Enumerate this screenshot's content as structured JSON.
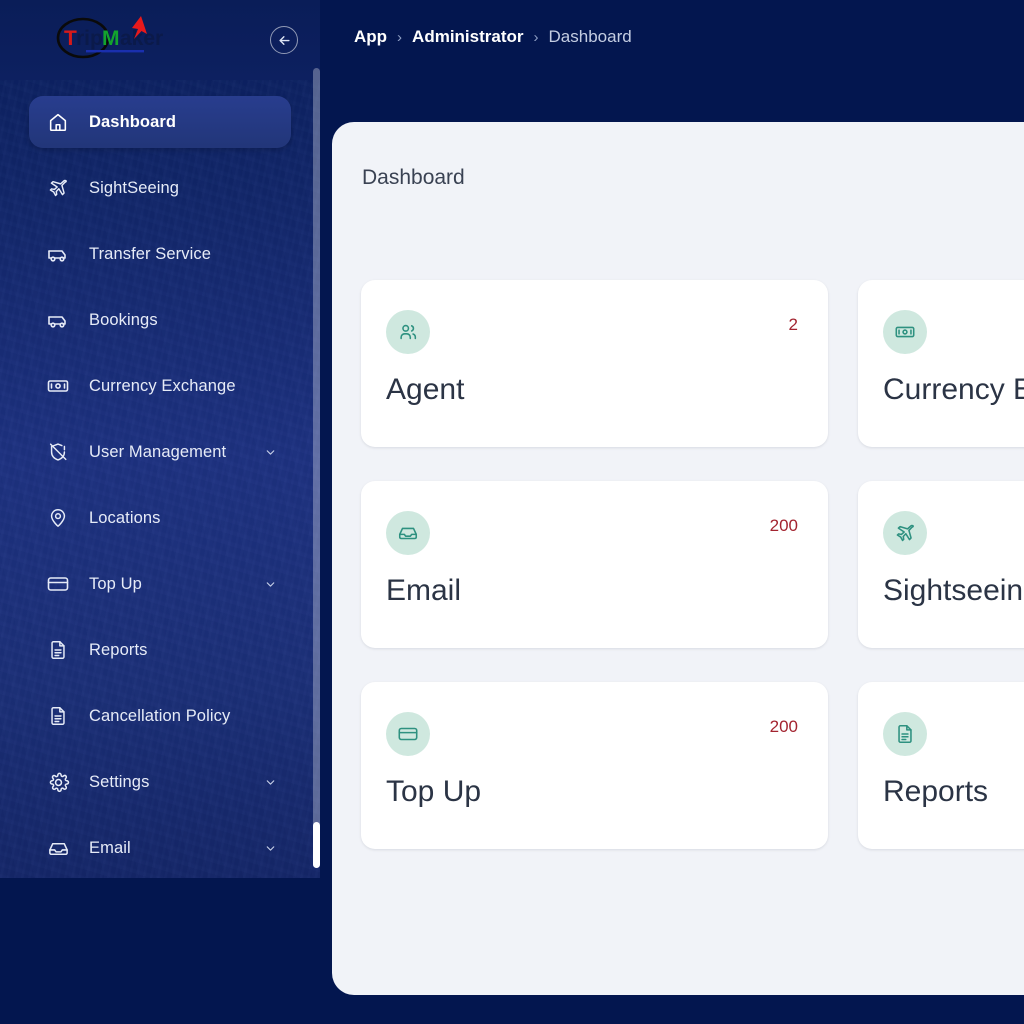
{
  "brand": {
    "name": "TripMaker",
    "letters": [
      {
        "t": "T",
        "color": "#d61a1a"
      },
      {
        "t": "rip",
        "color": "#0b1a4a"
      },
      {
        "t": "M",
        "color": "#13a32e"
      },
      {
        "t": "aker",
        "color": "#0b1a4a"
      }
    ],
    "accent_arrow_color": "#e8191b",
    "ring_color": "#0a0a0a"
  },
  "header": {
    "collapse_button_label": "Collapse sidebar",
    "collapse_icon": "arrow-left-circle-icon",
    "breadcrumb": {
      "items": [
        {
          "label": "App",
          "current": false
        },
        {
          "label": "Administrator",
          "current": false
        },
        {
          "label": "Dashboard",
          "current": true
        }
      ],
      "separator": "›"
    }
  },
  "sidebar": {
    "active_item": "Dashboard",
    "items": [
      {
        "label": "Dashboard",
        "icon": "home-icon",
        "active": true,
        "expandable": false
      },
      {
        "label": "SightSeeing",
        "icon": "plane-icon",
        "active": false,
        "expandable": false
      },
      {
        "label": "Transfer Service",
        "icon": "car-icon",
        "active": false,
        "expandable": false
      },
      {
        "label": "Bookings",
        "icon": "car-icon",
        "active": false,
        "expandable": false
      },
      {
        "label": "Currency Exchange",
        "icon": "banknote-icon",
        "active": false,
        "expandable": false
      },
      {
        "label": "User Management",
        "icon": "shield-off-icon",
        "active": false,
        "expandable": true
      },
      {
        "label": "Locations",
        "icon": "map-pin-icon",
        "active": false,
        "expandable": false
      },
      {
        "label": "Top Up",
        "icon": "credit-card-icon",
        "active": false,
        "expandable": true
      },
      {
        "label": "Reports",
        "icon": "document-icon",
        "active": false,
        "expandable": false
      },
      {
        "label": "Cancellation Policy",
        "icon": "document-icon",
        "active": false,
        "expandable": false
      },
      {
        "label": "Settings",
        "icon": "gear-icon",
        "active": false,
        "expandable": true
      },
      {
        "label": "Email",
        "icon": "inbox-icon",
        "active": false,
        "expandable": true
      }
    ],
    "scrollbar": {
      "name": "sidebar-scrollbar",
      "position": "bottom"
    }
  },
  "main": {
    "title": "Dashboard",
    "cards": [
      {
        "title": "Agent",
        "count": "2",
        "icon": "users-icon"
      },
      {
        "title": "Currency Exchange",
        "count": "",
        "icon": "banknote-icon"
      },
      {
        "title": "Email",
        "count": "200",
        "icon": "inbox-icon"
      },
      {
        "title": "Sightseeing",
        "count": "",
        "icon": "plane-icon"
      },
      {
        "title": "Top Up",
        "count": "200",
        "icon": "credit-card-icon"
      },
      {
        "title": "Reports",
        "count": "",
        "icon": "document-icon"
      }
    ]
  },
  "colors": {
    "page_background": "#03164f",
    "sidebar_gradient_top": "#0a1f5e",
    "sidebar_gradient_mid": "#1e3282",
    "panel_background": "#f1f3f8",
    "card_background": "#ffffff",
    "icon_circle": "#cfe8df",
    "icon_stroke": "#2e9180",
    "count_text": "#a32430",
    "card_title_text": "#2b3445",
    "active_nav_pill": "#283d8e"
  }
}
